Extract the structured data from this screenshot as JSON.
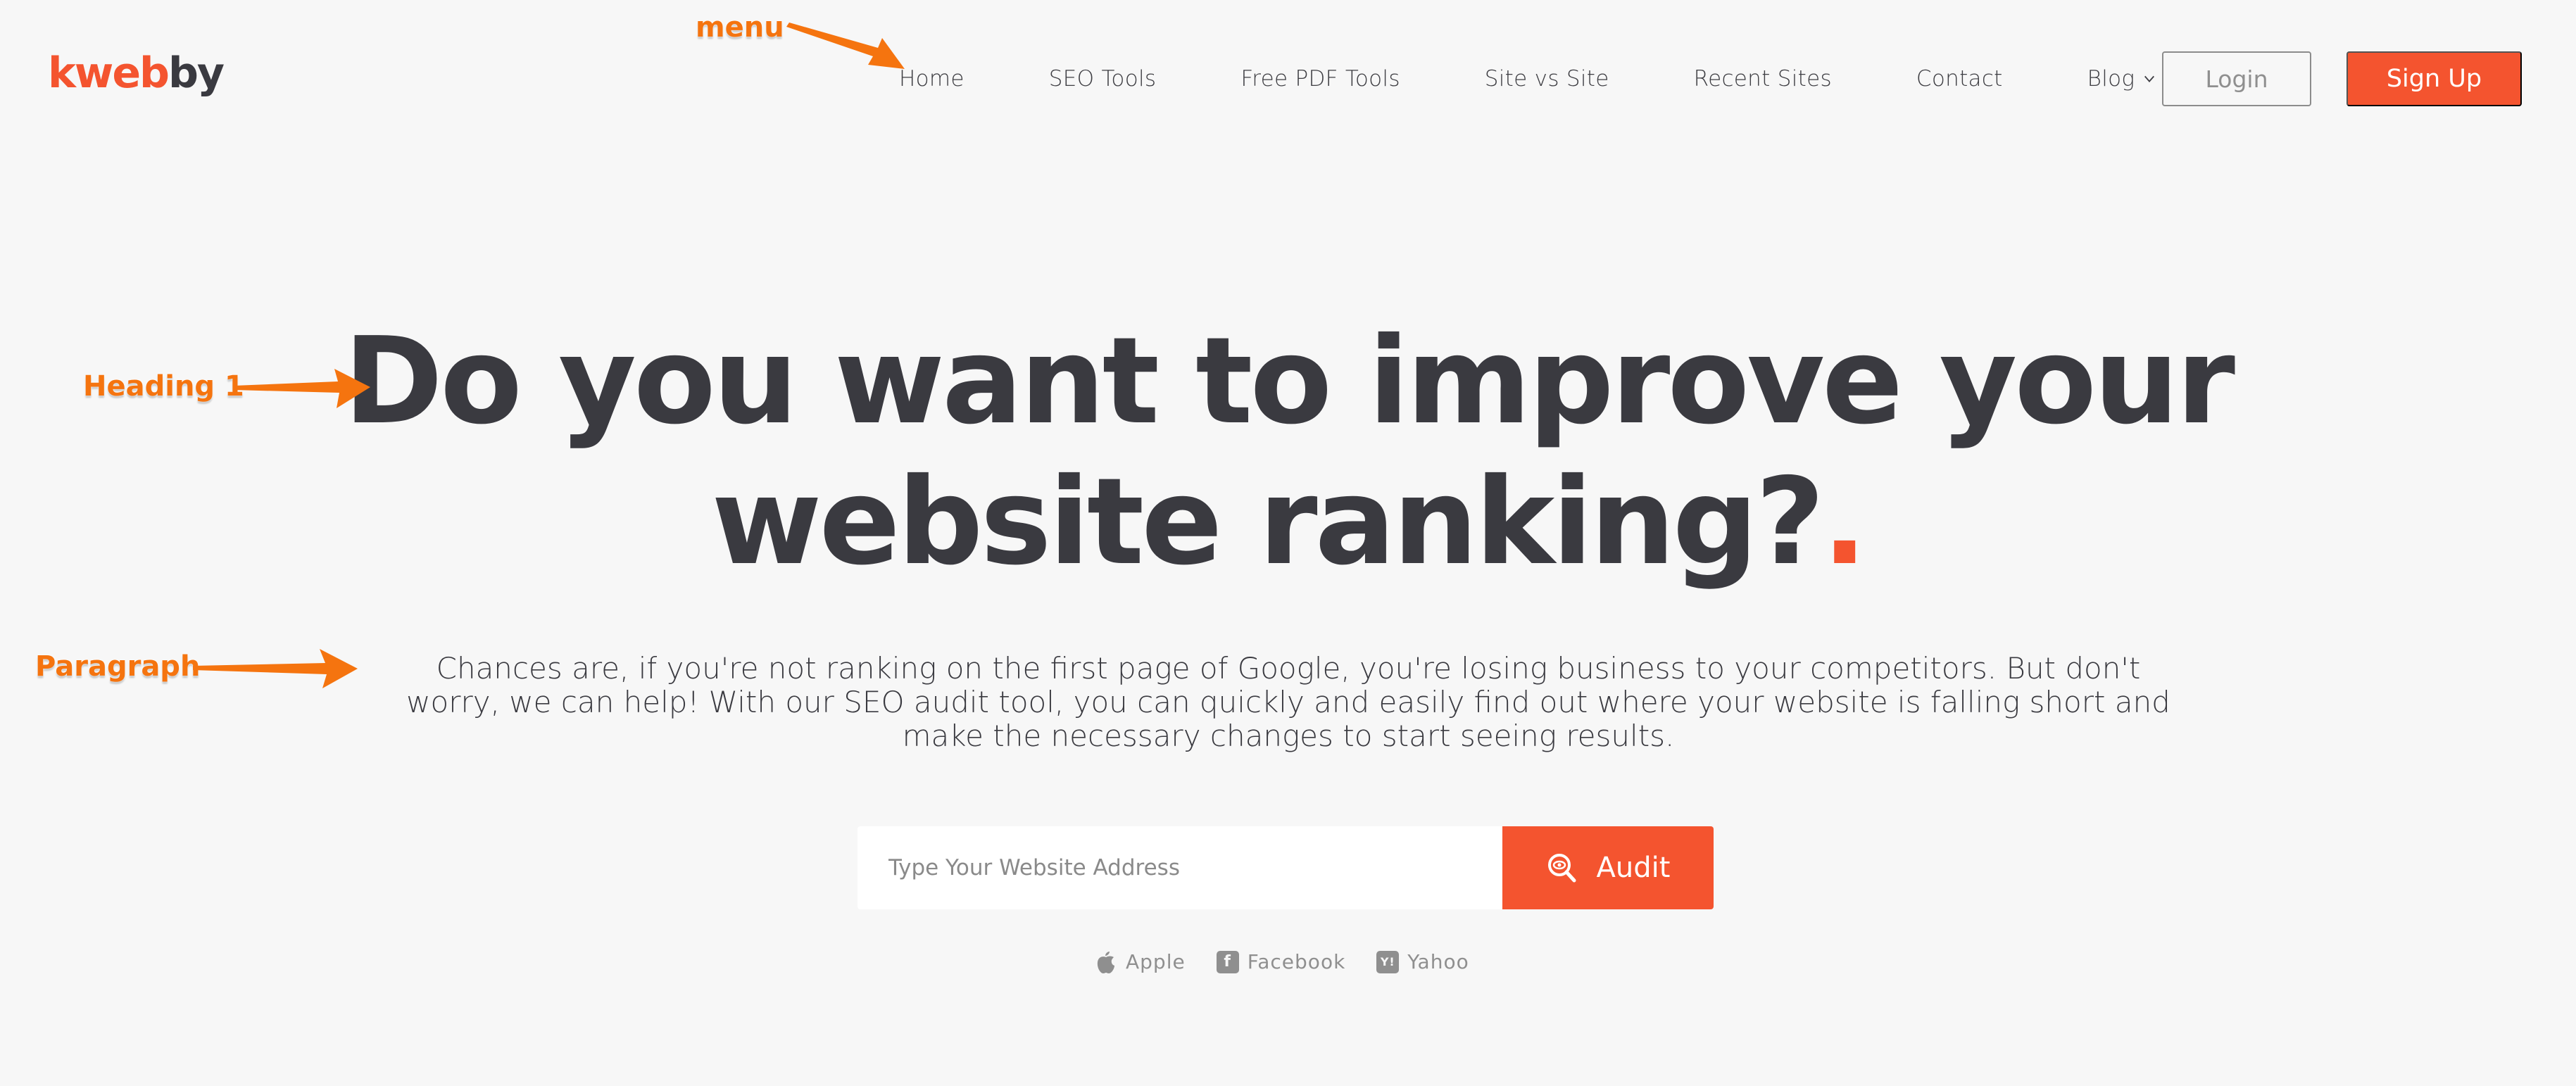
{
  "header": {
    "logo": {
      "part1": "k",
      "part2": "web",
      "part3": "by"
    },
    "nav": [
      {
        "label": "Home"
      },
      {
        "label": "SEO Tools"
      },
      {
        "label": "Free PDF Tools"
      },
      {
        "label": "Site vs Site"
      },
      {
        "label": "Recent Sites"
      },
      {
        "label": "Contact"
      },
      {
        "label": "Blog",
        "has_dropdown": true
      }
    ],
    "login_label": "Login",
    "signup_label": "Sign Up"
  },
  "hero": {
    "title_line1": "Do you want to improve your",
    "title_line2": "website ranking?",
    "title_dot": ".",
    "paragraph": "Chances are, if you're not ranking on the first page of Google, you're losing business to your competitors. But don't worry, we can help! With our SEO audit tool, you can quickly and easily find out where your website is falling short and make the necessary changes to start seeing results."
  },
  "search": {
    "placeholder": "Type Your Website Address",
    "value": "",
    "button_label": "Audit",
    "button_icon": "search-eye-icon"
  },
  "brands": [
    {
      "label": "Apple",
      "icon": "apple-icon"
    },
    {
      "label": "Facebook",
      "icon": "facebook-icon"
    },
    {
      "label": "Yahoo",
      "icon": "yahoo-icon"
    }
  ],
  "annotations": {
    "menu": "menu",
    "heading": "Heading 1",
    "paragraph": "Paragraph"
  },
  "colors": {
    "accent": "#f4542f",
    "text_dark": "#3a3a40",
    "background": "#f7f7f7",
    "annotation": "#f5740f"
  }
}
